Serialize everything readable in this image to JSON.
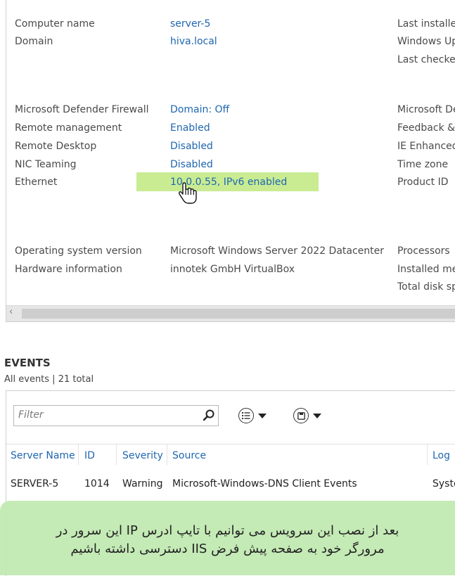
{
  "properties": {
    "group1": [
      {
        "label": "Computer name",
        "value": "server-5"
      },
      {
        "label": "Domain",
        "value": "hiva.local"
      }
    ],
    "group1_right": [
      "Last installed",
      "Windows Up",
      "Last checked"
    ],
    "group2": [
      {
        "label": "Microsoft Defender Firewall",
        "value": "Domain: Off"
      },
      {
        "label": "Remote management",
        "value": "Enabled"
      },
      {
        "label": "Remote Desktop",
        "value": "Disabled"
      },
      {
        "label": "NIC Teaming",
        "value": "Disabled"
      },
      {
        "label": "Ethernet",
        "value": "10.0.0.55, IPv6 enabled"
      }
    ],
    "group2_right": [
      "Microsoft De",
      "Feedback &",
      "IE Enhanced",
      "Time zone",
      "Product ID"
    ],
    "group3": [
      {
        "label": "Operating system version",
        "value": "Microsoft Windows Server 2022 Datacenter"
      },
      {
        "label": "Hardware information",
        "value": "innotek GmbH VirtualBox"
      }
    ],
    "group3_right": [
      "Processors",
      "Installed me",
      "Total disk sp"
    ],
    "scroll_left": "‹"
  },
  "events": {
    "title": "EVENTS",
    "subtitle": "All events | 21 total",
    "filter_placeholder": "Filter",
    "columns": [
      "Server Name",
      "ID",
      "Severity",
      "Source",
      "Log"
    ],
    "rows": [
      [
        "SERVER-5",
        "1014",
        "Warning",
        "Microsoft-Windows-DNS Client Events",
        "Syste"
      ]
    ]
  },
  "caption": {
    "line1": "بعد از نصب این سرویس می توانیم با تایپ ادرس IP این سرور در",
    "line2": "مرورگر خود به صفحه پیش فرض IIS دسترسی داشته باشیم"
  },
  "colors": {
    "link": "#1f66b0",
    "highlight": "#c9ec93",
    "caption_bg": "#c0e8b0"
  }
}
